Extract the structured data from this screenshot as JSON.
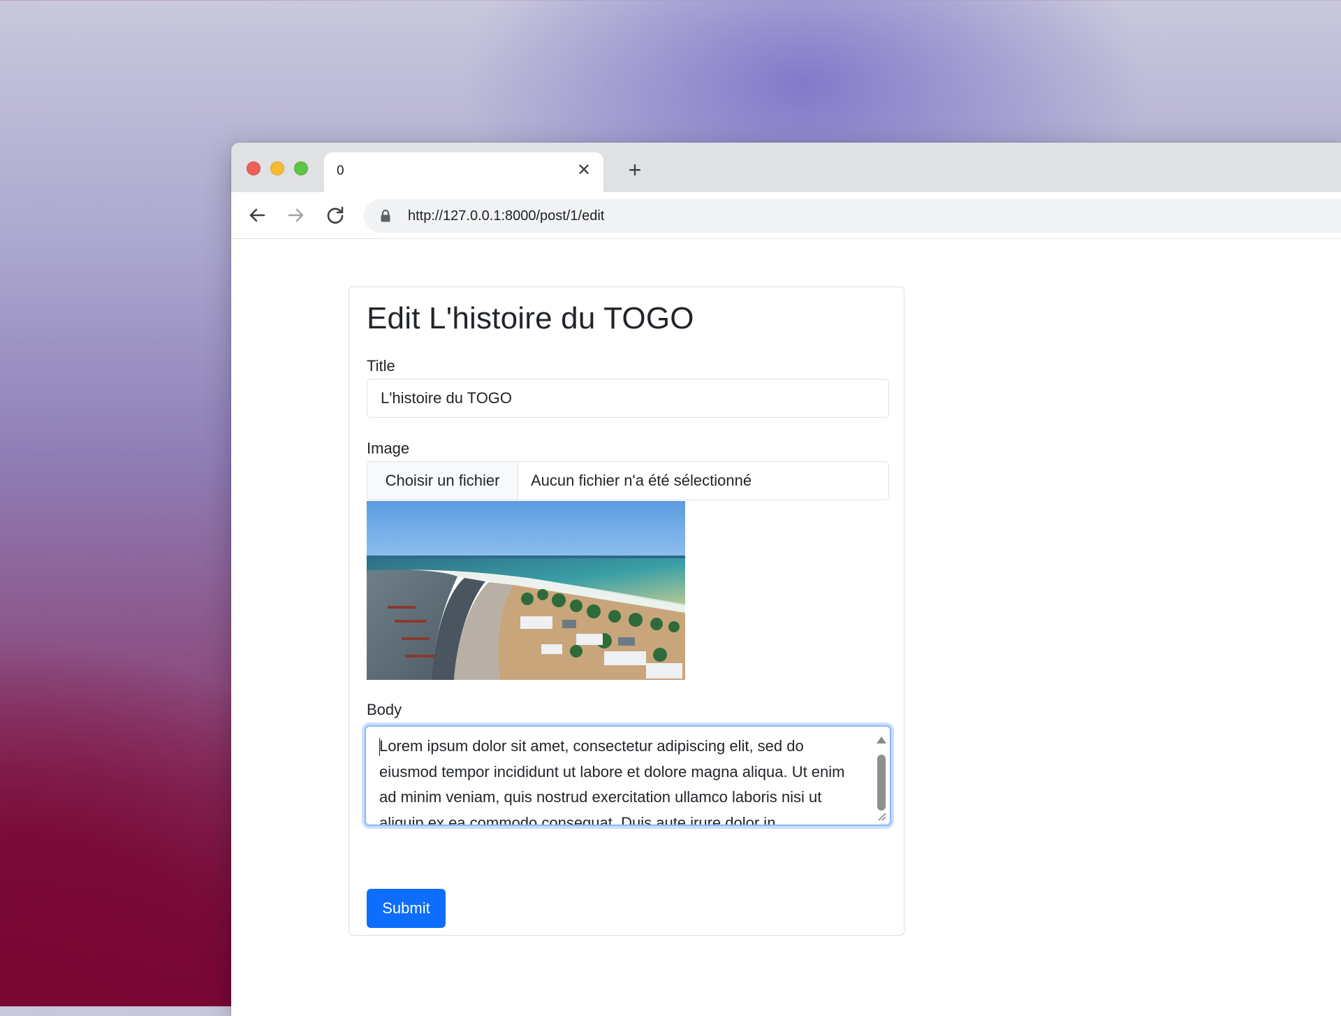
{
  "browser": {
    "tab_title": "0",
    "url": "http://127.0.0.1:8000/post/1/edit",
    "icons": [
      "close-icon",
      "plus-icon",
      "arrow-left-icon",
      "arrow-right-icon",
      "reload-icon",
      "lock-icon"
    ]
  },
  "form": {
    "heading": "Edit L'histoire du TOGO",
    "title_label": "Title",
    "title_value": "L'histoire du TOGO",
    "image_label": "Image",
    "file_button": "Choisir un fichier",
    "file_status": "Aucun fichier n'a été sélectionné",
    "body_label": "Body",
    "body_value": "Lorem ipsum dolor sit amet, consectetur adipiscing elit, sed do eiusmod tempor incididunt ut labore et dolore magna aliqua. Ut enim ad minim veniam, quis nostrud exercitation ullamco laboris nisi ut aliquip ex ea commodo consequat. Duis aute irure dolor in reprehenderit in voluptate velit esse cillum dolore eu fugiat nulla",
    "submit_label": "Submit"
  },
  "colors": {
    "primary": "#0d6efd",
    "focus_ring": "#86b7fe",
    "traffic_red": "#ee5f58",
    "traffic_yellow": "#f6bd31",
    "traffic_green": "#5fc545"
  }
}
